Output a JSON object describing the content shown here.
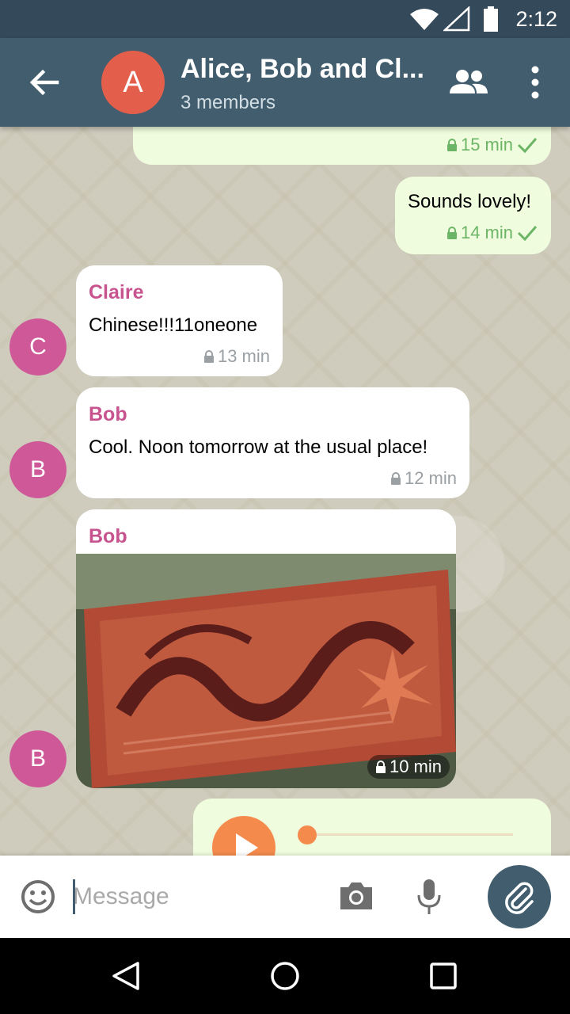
{
  "status_bar": {
    "time": "2:12",
    "icons": [
      "wifi-icon",
      "signal-icon",
      "battery-icon"
    ]
  },
  "header": {
    "avatar_letter": "A",
    "title": "Alice, Bob and Cl...",
    "subtitle": "3 members",
    "avatar_color": "#e45f4b",
    "bar_color": "#425e6e"
  },
  "messages": [
    {
      "direction": "out",
      "text": "",
      "time": "15 min",
      "status": "sent"
    },
    {
      "direction": "out",
      "text": "Sounds lovely!",
      "time": "14 min",
      "status": "sent"
    },
    {
      "direction": "in",
      "sender": "Claire",
      "avatar_letter": "C",
      "text": "Chinese!!!11oneone",
      "time": "13 min"
    },
    {
      "direction": "in",
      "sender": "Bob",
      "avatar_letter": "B",
      "text": "Cool. Noon tomorrow at the usual place!",
      "time": "12 min"
    },
    {
      "direction": "in",
      "sender": "Bob",
      "avatar_letter": "B",
      "type": "photo",
      "time": "10 min"
    },
    {
      "direction": "out",
      "type": "voice"
    }
  ],
  "input": {
    "placeholder": "Message"
  },
  "colors": {
    "sender_name": "#c7538f",
    "outgoing_bubble": "#effdde",
    "check": "#6db566",
    "voice_accent": "#f48a4c"
  }
}
